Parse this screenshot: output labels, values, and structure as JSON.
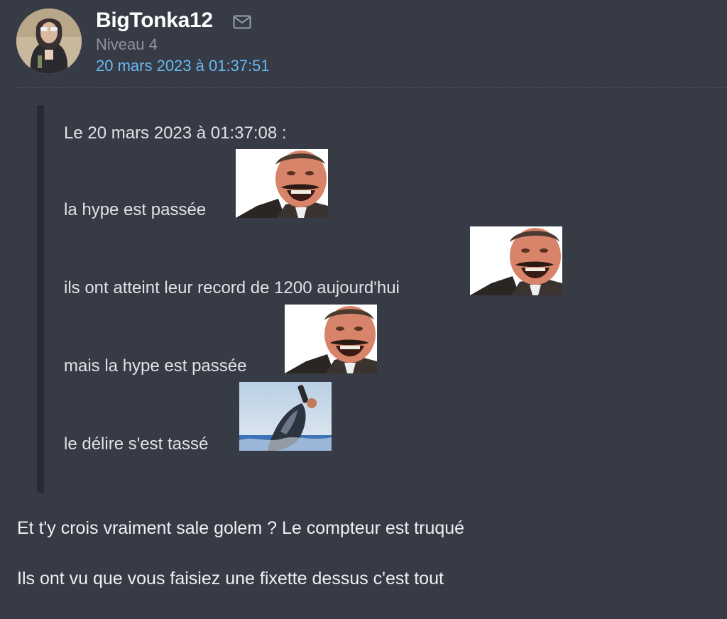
{
  "post": {
    "author": {
      "name": "BigTonka12",
      "level": "Niveau 4",
      "avatar_icon": "user-avatar-photo"
    },
    "date": "20 mars 2023 à 01:37:51",
    "message_icon": "envelope-icon",
    "quote": {
      "header": "Le 20 mars 2023 à 01:37:08 :",
      "lines": [
        {
          "text": "la hype est passée",
          "sticker": "risitas-laughing-sticker"
        },
        {
          "text": "ils ont atteint leur record de 1200 aujourd'hui",
          "sticker": "risitas-laughing-sticker"
        },
        {
          "text": "mais la hype est passée",
          "sticker": "risitas-laughing-sticker"
        },
        {
          "text": "le délire s'est tassé",
          "sticker": "whale-jump-sticker"
        }
      ]
    },
    "body": [
      "Et t'y crois vraiment sale golem ? Le compteur est truqué",
      "Ils ont vu que vous faisiez une fixette dessus c'est tout"
    ]
  },
  "colors": {
    "background": "#363b46",
    "author_name": "#ffffff",
    "level": "#8e939c",
    "date_link": "#6ab8f0",
    "quote_bar": "#272b33",
    "text": "#e6e8ec"
  }
}
